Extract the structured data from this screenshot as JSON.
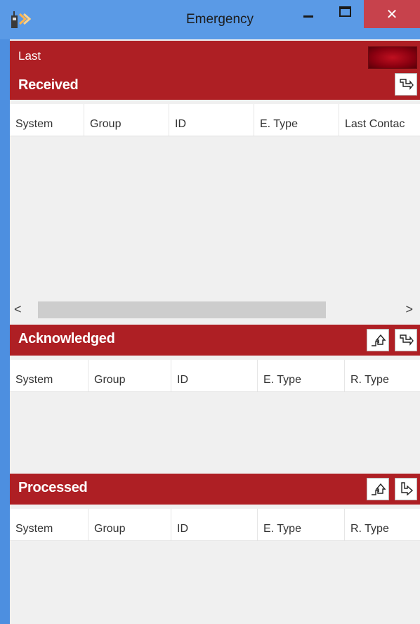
{
  "window": {
    "title": "Emergency",
    "minimize_glyph": "—",
    "maximize_glyph": "☐",
    "close_glyph": "✕",
    "app_icon": "radio-icon"
  },
  "last": {
    "label": "Last",
    "indicator": "status-led"
  },
  "received": {
    "title": "Received",
    "columns": [
      "System",
      "Group",
      "ID",
      "E. Type",
      "Last Contac"
    ],
    "buttons": [
      "move-down-icon"
    ]
  },
  "acknowledged": {
    "title": "Acknowledged",
    "columns": [
      "System",
      "Group",
      "ID",
      "E. Type",
      "R. Type"
    ],
    "buttons": [
      "move-up-icon",
      "move-down-icon"
    ]
  },
  "processed": {
    "title": "Processed",
    "columns": [
      "System",
      "Group",
      "ID",
      "E. Type",
      "R. Type"
    ],
    "buttons": [
      "move-up-icon",
      "move-back-icon"
    ]
  },
  "scrollbar": {
    "left_glyph": "<",
    "right_glyph": ">"
  },
  "colors": {
    "titlebar": "#5a9ae6",
    "band": "#ae1f24",
    "close": "#c7424c",
    "panel": "#f0f0f0"
  }
}
